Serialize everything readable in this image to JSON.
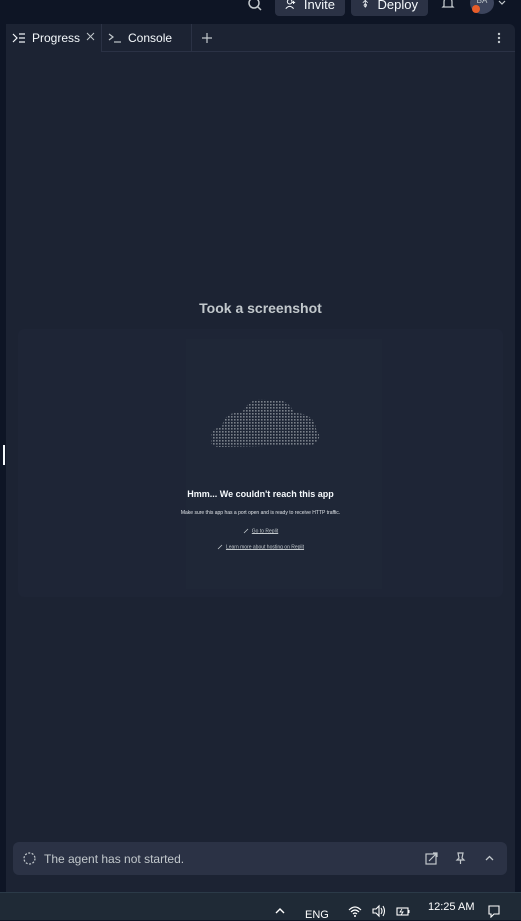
{
  "topbar": {
    "invite_label": "Invite",
    "deploy_label": "Deploy",
    "avatar_initials": "BA"
  },
  "tabs": [
    {
      "label": "Progress",
      "icon": "progress-icon",
      "active": true
    },
    {
      "label": "Console",
      "icon": "terminal-icon",
      "active": false
    }
  ],
  "main": {
    "heading": "Took a screenshot",
    "screenshot": {
      "title": "Hmm... We couldn't reach this app",
      "subtitle": "Make sure this app has a port open and is ready to receive HTTP traffic.",
      "link1": "Go to Replit",
      "link2": "Learn more about hosting on Replit"
    }
  },
  "agent": {
    "status": "The agent has not started."
  },
  "taskbar": {
    "language": "ENG",
    "time": "12:25 AM"
  },
  "colors": {
    "background": "#0e1525",
    "pane": "#1c2333",
    "surface": "#2b3245",
    "text": "#f5f9fc",
    "muted": "#c2c8cc",
    "avatar_badge": "#e85d2a"
  }
}
